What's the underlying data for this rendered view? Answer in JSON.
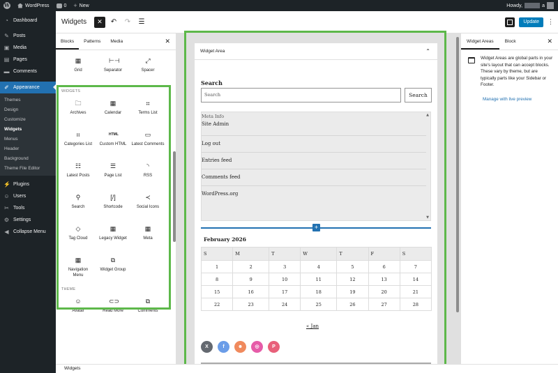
{
  "admin_bar": {
    "site_name": "WordPress",
    "comments_count": "0",
    "new_label": "New",
    "howdy": "Howdy,",
    "user_suffix": "a"
  },
  "sidebar": {
    "items": [
      {
        "label": "Dashboard",
        "icon": "dashboard-icon"
      },
      {
        "label": "Posts",
        "icon": "pin-icon"
      },
      {
        "label": "Media",
        "icon": "media-icon"
      },
      {
        "label": "Pages",
        "icon": "pages-icon"
      },
      {
        "label": "Comments",
        "icon": "comments-icon"
      },
      {
        "label": "Appearance",
        "icon": "brush-icon"
      }
    ],
    "submenu": [
      "Themes",
      "Design",
      "Customize",
      "Widgets",
      "Menus",
      "Header",
      "Background",
      "Theme File Editor"
    ],
    "items_after": [
      {
        "label": "Plugins",
        "icon": "plugins-icon"
      },
      {
        "label": "Users",
        "icon": "users-icon"
      },
      {
        "label": "Tools",
        "icon": "tools-icon"
      },
      {
        "label": "Settings",
        "icon": "settings-icon"
      },
      {
        "label": "Collapse Menu",
        "icon": "collapse-icon"
      }
    ]
  },
  "header": {
    "title": "Widgets",
    "update_label": "Update"
  },
  "inserter": {
    "tabs": [
      "Blocks",
      "Patterns",
      "Media"
    ],
    "top_blocks": [
      {
        "label": "Grid",
        "icon": "grid-icon"
      },
      {
        "label": "Separator",
        "icon": "separator-icon"
      },
      {
        "label": "Spacer",
        "icon": "spacer-icon"
      }
    ],
    "widgets_label": "WIDGETS",
    "widgets": [
      {
        "label": "Archives",
        "icon": "archive-icon"
      },
      {
        "label": "Calendar",
        "icon": "calendar-icon"
      },
      {
        "label": "Terms List",
        "icon": "categories-icon"
      },
      {
        "label": "Categories List",
        "icon": "categories-icon"
      },
      {
        "label": "Custom HTML",
        "icon": "html-icon"
      },
      {
        "label": "Latest Comments",
        "icon": "comment-icon"
      },
      {
        "label": "Latest Posts",
        "icon": "post-list-icon"
      },
      {
        "label": "Page List",
        "icon": "page-list-icon"
      },
      {
        "label": "RSS",
        "icon": "rss-icon"
      },
      {
        "label": "Search",
        "icon": "search-icon"
      },
      {
        "label": "Shortcode",
        "icon": "shortcode-icon"
      },
      {
        "label": "Social Icons",
        "icon": "share-icon"
      },
      {
        "label": "Tag Cloud",
        "icon": "tag-icon"
      },
      {
        "label": "Legacy Widget",
        "icon": "widget-icon"
      },
      {
        "label": "Meta",
        "icon": "widget-icon"
      },
      {
        "label": "Navigation Menu",
        "icon": "widget-icon"
      },
      {
        "label": "Widget Group",
        "icon": "group-icon"
      }
    ],
    "theme_label": "THEME",
    "theme_blocks": [
      {
        "label": "Avatar",
        "icon": "avatar-icon"
      },
      {
        "label": "Read More",
        "icon": "link-icon"
      },
      {
        "label": "Comments",
        "icon": "comments-icon"
      }
    ]
  },
  "canvas": {
    "area_title": "Widget Area",
    "search": {
      "title": "Search",
      "placeholder": "Search",
      "button": "Search"
    },
    "meta": {
      "heading": "Meta Info",
      "links": [
        "Site Admin",
        "Log out",
        "Entries feed",
        "Comments feed",
        "WordPress.org"
      ]
    },
    "calendar": {
      "caption": "February 2026",
      "days": [
        "S",
        "M",
        "T",
        "W",
        "T",
        "F",
        "S"
      ],
      "weeks": [
        [
          "1",
          "2",
          "3",
          "4",
          "5",
          "6",
          "7"
        ],
        [
          "8",
          "9",
          "10",
          "11",
          "12",
          "13",
          "14"
        ],
        [
          "15",
          "16",
          "17",
          "18",
          "19",
          "20",
          "21"
        ],
        [
          "22",
          "23",
          "24",
          "25",
          "26",
          "27",
          "28"
        ]
      ],
      "prev": "« Jan"
    },
    "social": [
      {
        "name": "x-icon",
        "glyph": "𝕏",
        "color": "#646970"
      },
      {
        "name": "facebook-icon",
        "glyph": "f",
        "color": "#6b9de8"
      },
      {
        "name": "reddit-icon",
        "glyph": "☻",
        "color": "#f08a5d"
      },
      {
        "name": "instagram-icon",
        "glyph": "◎",
        "color": "#e65ca8"
      },
      {
        "name": "pinterest-icon",
        "glyph": "P",
        "color": "#e8607a"
      }
    ]
  },
  "settings": {
    "tabs": [
      "Widget Areas",
      "Block"
    ],
    "description": "Widget Areas are global parts in your site's layout that can accept blocks. These vary by theme, but are typically parts like your Sidebar or Footer.",
    "link": "Manage with live preview"
  },
  "footer": {
    "breadcrumb": "Widgets"
  },
  "colors": {
    "accent": "#2271b1",
    "highlight": "#5db84a",
    "admin_dark": "#1d2327"
  }
}
